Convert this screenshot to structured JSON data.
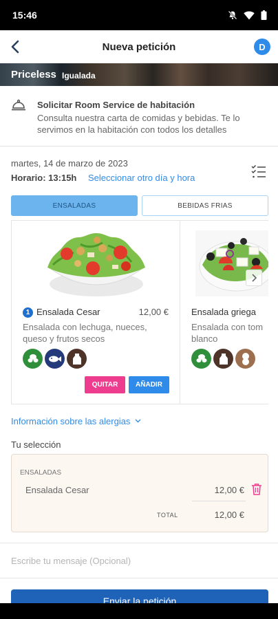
{
  "status_bar": {
    "time": "15:46"
  },
  "header": {
    "title": "Nueva petición",
    "avatar_initial": "D"
  },
  "banner": {
    "name": "Priceless",
    "location": "Igualada"
  },
  "room_service": {
    "title": "Solicitar Room Service de habitación",
    "description": "Consulta nuestra carta de comidas y bebidas. Te lo servimos en la habitación con todos los detalles"
  },
  "schedule": {
    "date": "martes, 14 de marzo de 2023",
    "time_label": "Horario: 13:15h",
    "change_link": "Seleccionar otro día y hora"
  },
  "tabs": [
    {
      "label": "ENSALADAS",
      "active": true
    },
    {
      "label": "BEBIDAS FRIAS",
      "active": false
    }
  ],
  "products": [
    {
      "quantity": "1",
      "name": "Ensalada Cesar",
      "price": "12,00 €",
      "description": "Ensalada con lechuga, nueces, queso y frutos secos",
      "allergens": [
        "nuts-icon",
        "fish-icon",
        "dairy-icon"
      ],
      "remove_label": "QUITAR",
      "add_label": "AÑADIR"
    },
    {
      "name": "Ensalada griega",
      "description": "Ensalada con tom blanco",
      "allergens": [
        "nuts-icon",
        "dairy-icon",
        "peanut-icon"
      ]
    }
  ],
  "allergy_info_link": "Información sobre las alergias",
  "selection": {
    "heading": "Tu selección",
    "category": "ENSALADAS",
    "items": [
      {
        "name": "Ensalada Cesar",
        "price": "12,00 €"
      }
    ],
    "total_label": "TOTAL",
    "total_value": "12,00 €"
  },
  "message": {
    "placeholder": "Escribe tu mensaje (Opcional)",
    "value": ""
  },
  "submit_label": "Enviar la petición",
  "colors": {
    "accent": "#2f8bea",
    "primary_button": "#1f63b8",
    "remove_button": "#ee3d8f",
    "active_tab": "#6cb4ee"
  }
}
